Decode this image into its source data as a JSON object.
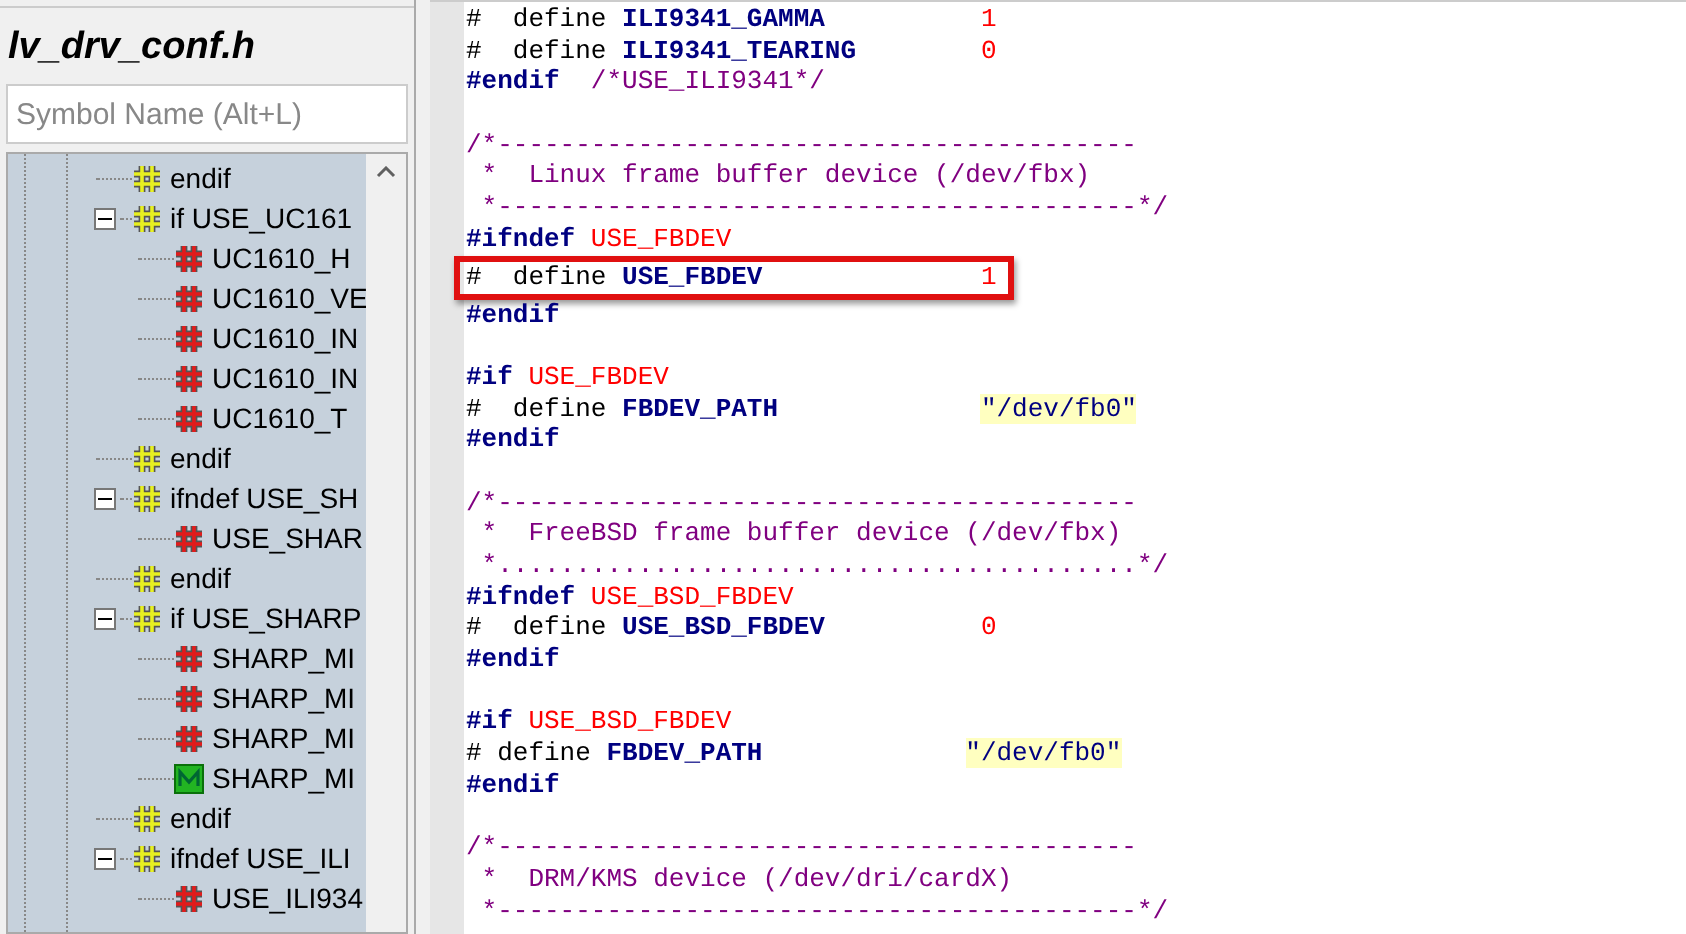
{
  "sidebar": {
    "title": "lv_drv_conf.h",
    "search": {
      "placeholder": "Symbol Name (Alt+L)"
    },
    "tree": [
      {
        "kind": "directive",
        "label": "endif"
      },
      {
        "kind": "directive",
        "label": "if USE_UC161",
        "expanded": true,
        "children": [
          {
            "kind": "define",
            "label": "UC1610_H"
          },
          {
            "kind": "define",
            "label": "UC1610_VE"
          },
          {
            "kind": "define",
            "label": "UC1610_IN"
          },
          {
            "kind": "define",
            "label": "UC1610_IN"
          },
          {
            "kind": "define",
            "label": "UC1610_T"
          }
        ]
      },
      {
        "kind": "directive",
        "label": "endif"
      },
      {
        "kind": "directive",
        "label": "ifndef USE_SH",
        "expanded": true,
        "children": [
          {
            "kind": "define",
            "label": "USE_SHAR"
          }
        ]
      },
      {
        "kind": "directive",
        "label": "endif"
      },
      {
        "kind": "directive",
        "label": "if USE_SHARP",
        "expanded": true,
        "children": [
          {
            "kind": "define",
            "label": "SHARP_MI"
          },
          {
            "kind": "define",
            "label": "SHARP_MI"
          },
          {
            "kind": "define",
            "label": "SHARP_MI"
          },
          {
            "kind": "macro",
            "label": "SHARP_MI"
          }
        ]
      },
      {
        "kind": "directive",
        "label": "endif"
      },
      {
        "kind": "directive",
        "label": "ifndef USE_ILI",
        "expanded": true,
        "children": [
          {
            "kind": "define",
            "label": "USE_ILI934"
          }
        ]
      }
    ]
  },
  "editor": {
    "blocks": [
      [
        {
          "tokens": [
            {
              "kind": "plain",
              "text": "#  define "
            },
            {
              "kind": "name",
              "text": "ILI9341_GAMMA"
            },
            {
              "kind": "number",
              "text": "1"
            }
          ]
        },
        {
          "tokens": [
            {
              "kind": "plain",
              "text": "#  define "
            },
            {
              "kind": "name",
              "text": "ILI9341_TEARING"
            },
            {
              "kind": "number",
              "text": "0"
            }
          ]
        },
        {
          "tokens": [
            {
              "kind": "keyword",
              "text": "#endif"
            },
            {
              "kind": "comment",
              "text": "  /*USE_ILI9341*/"
            }
          ]
        }
      ],
      [
        {
          "tokens": [
            {
              "kind": "comment",
              "text": "/*-----------------------------------------"
            }
          ]
        },
        {
          "tokens": [
            {
              "kind": "comment",
              "text": " *  Linux frame buffer device (/dev/fbx)"
            }
          ]
        },
        {
          "tokens": [
            {
              "kind": "comment",
              "text": " *-----------------------------------------*/"
            }
          ]
        },
        {
          "tokens": [
            {
              "kind": "keyword",
              "text": "#ifndef"
            },
            {
              "kind": "condition",
              "text": " USE_FBDEV"
            }
          ]
        },
        {
          "highlighted": true,
          "tokens": [
            {
              "kind": "plain",
              "text": "#  define "
            },
            {
              "kind": "name",
              "text": "USE_FBDEV"
            },
            {
              "kind": "number",
              "text": "1"
            }
          ]
        },
        {
          "tokens": [
            {
              "kind": "keyword",
              "text": "#endif"
            }
          ]
        }
      ],
      [
        {
          "tokens": [
            {
              "kind": "keyword",
              "text": "#if"
            },
            {
              "kind": "condition",
              "text": " USE_FBDEV"
            }
          ]
        },
        {
          "tokens": [
            {
              "kind": "plain",
              "text": "#  define "
            },
            {
              "kind": "name",
              "text": "FBDEV_PATH"
            },
            {
              "kind": "string",
              "text": "\"/dev/fb0\""
            }
          ]
        },
        {
          "tokens": [
            {
              "kind": "keyword",
              "text": "#endif"
            }
          ]
        }
      ],
      [
        {
          "tokens": [
            {
              "kind": "comment",
              "text": "/*-----------------------------------------"
            }
          ]
        },
        {
          "tokens": [
            {
              "kind": "comment",
              "text": " *  FreeBSD frame buffer device (/dev/fbx)"
            }
          ]
        },
        {
          "tokens": [
            {
              "kind": "comment",
              "text": " *.........................................*/"
            }
          ]
        },
        {
          "tokens": [
            {
              "kind": "keyword",
              "text": "#ifndef"
            },
            {
              "kind": "condition",
              "text": " USE_BSD_FBDEV"
            }
          ]
        },
        {
          "tokens": [
            {
              "kind": "plain",
              "text": "#  define "
            },
            {
              "kind": "name",
              "text": "USE_BSD_FBDEV"
            },
            {
              "kind": "number",
              "text": "0"
            }
          ]
        },
        {
          "tokens": [
            {
              "kind": "keyword",
              "text": "#endif"
            }
          ]
        }
      ],
      [
        {
          "tokens": [
            {
              "kind": "keyword",
              "text": "#if"
            },
            {
              "kind": "condition",
              "text": " USE_BSD_FBDEV"
            }
          ]
        },
        {
          "tokens": [
            {
              "kind": "plain",
              "text": "# define "
            },
            {
              "kind": "name",
              "text": "FBDEV_PATH"
            },
            {
              "kind": "string",
              "text": "\"/dev/fb0\""
            }
          ]
        },
        {
          "tokens": [
            {
              "kind": "keyword",
              "text": "#endif"
            }
          ]
        }
      ],
      [
        {
          "tokens": [
            {
              "kind": "comment",
              "text": "/*-----------------------------------------"
            }
          ]
        },
        {
          "tokens": [
            {
              "kind": "comment",
              "text": " *  DRM/KMS device (/dev/dri/cardX)"
            }
          ]
        },
        {
          "tokens": [
            {
              "kind": "comment",
              "text": " *-----------------------------------------*/"
            }
          ]
        }
      ]
    ]
  }
}
